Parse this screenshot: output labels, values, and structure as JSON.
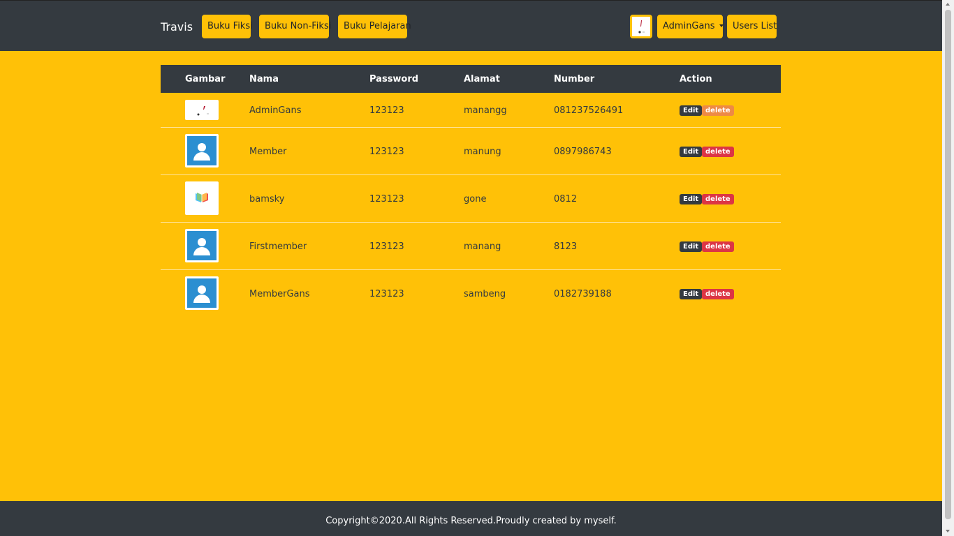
{
  "navbar": {
    "brand": "Travis",
    "links": [
      "Buku Fiksi",
      "Buku Non-Fiksi",
      "Buku Pelajaran"
    ],
    "user_menu": "AdminGans",
    "users_list": "Users List"
  },
  "table": {
    "headers": [
      "Gambar",
      "Nama",
      "Password",
      "Alamat",
      "Number",
      "Action"
    ],
    "rows": [
      {
        "nama": "AdminGans",
        "password": "123123",
        "alamat": "manangg",
        "number": "081237526491",
        "image": "admin-image"
      },
      {
        "nama": "Member",
        "password": "123123",
        "alamat": "manung",
        "number": "0897986743",
        "image": "person-icon"
      },
      {
        "nama": "bamsky",
        "password": "123123",
        "alamat": "gone",
        "number": "0812",
        "image": "book-icon"
      },
      {
        "nama": "Firstmember",
        "password": "123123",
        "alamat": "manang",
        "number": "8123",
        "image": "person-icon"
      },
      {
        "nama": "MemberGans",
        "password": "123123",
        "alamat": "sambeng",
        "number": "0182739188",
        "image": "person-icon"
      }
    ],
    "edit_label": "Edit",
    "delete_label": "delete"
  },
  "footer": {
    "text": "Copyright©2020.All Rights Reserved.Proudly created by myself."
  },
  "colors": {
    "background": "#ffc107",
    "navbar": "#343a40",
    "delete": "#dc3545"
  }
}
